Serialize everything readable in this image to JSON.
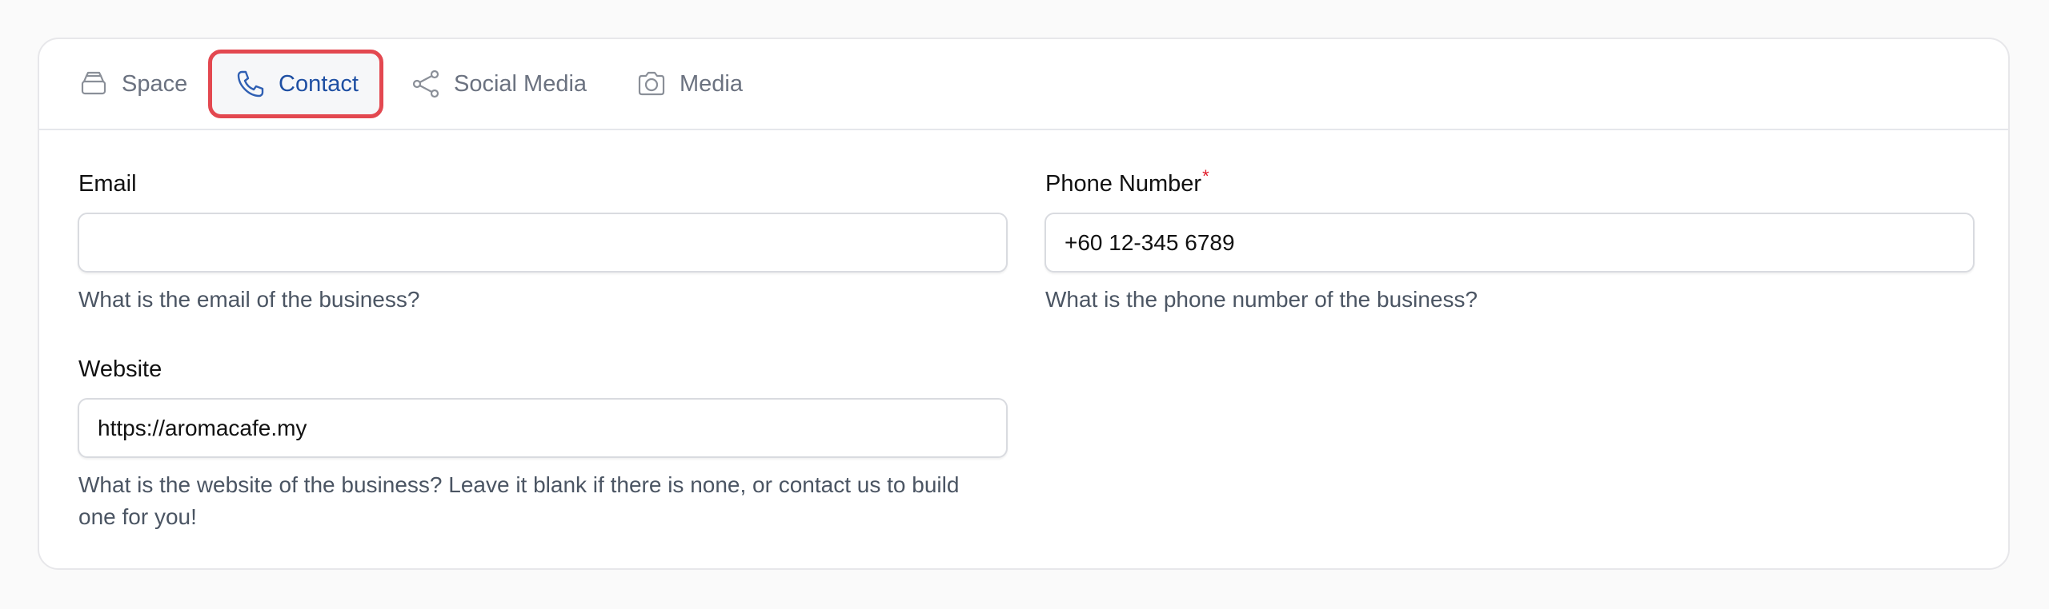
{
  "tabs": [
    {
      "label": "Space",
      "icon": "layers-icon",
      "active": false
    },
    {
      "label": "Contact",
      "icon": "phone-icon",
      "active": true
    },
    {
      "label": "Social Media",
      "icon": "share-icon",
      "active": false
    },
    {
      "label": "Media",
      "icon": "camera-icon",
      "active": false
    }
  ],
  "form": {
    "email": {
      "label": "Email",
      "value": "",
      "placeholder": "",
      "help": "What is the email of the business?"
    },
    "phone": {
      "label": "Phone Number",
      "required_mark": "*",
      "value": "+60 12-345 6789",
      "help": "What is the phone number of the business?"
    },
    "website": {
      "label": "Website",
      "value": "https://aromacafe.my",
      "help": "What is the website of the business? Leave it blank if there is none, or contact us to build one for you!"
    }
  },
  "colors": {
    "active_tab_text": "#1e4fa3",
    "active_tab_outline": "#e34850",
    "required_mark": "#e11d2a",
    "inactive_tab_text": "#6b7280"
  }
}
